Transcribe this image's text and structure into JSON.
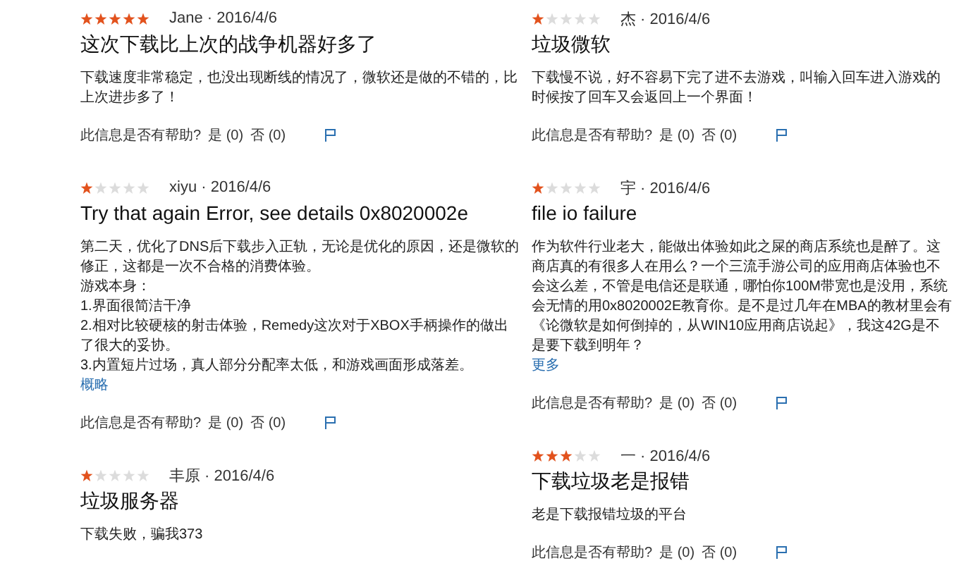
{
  "columns": [
    {
      "reviews": [
        {
          "stars": 5,
          "author": "Jane · 2016/4/6",
          "title": "这次下载比上次的战争机器好多了",
          "body": [
            "下载速度非常稳定，也没出现断线的情况了，微软还是做的不错的，比上次进步多了！"
          ],
          "helpful": {
            "prompt": "此信息是否有帮助?",
            "yes": "是 (0)",
            "no": "否 (0)"
          }
        },
        {
          "stars": 1,
          "author": "xiyu · 2016/4/6",
          "title": "Try that again Error, see details 0x8020002e",
          "body": [
            "第二天，优化了DNS后下载步入正轨，无论是优化的原因，还是微软的修正，这都是一次不合格的消费体验。",
            "游戏本身：",
            "1.界面很简洁干净",
            "2.相对比较硬核的射击体验，Remedy这次对于XBOX手柄操作的做出了很大的妥协。",
            "3.内置短片过场，真人部分分配率太低，和游戏画面形成落差。"
          ],
          "more": "概略",
          "helpful": {
            "prompt": "此信息是否有帮助?",
            "yes": "是 (0)",
            "no": "否 (0)"
          }
        },
        {
          "stars": 1,
          "author": "丰原 · 2016/4/6",
          "title": "垃圾服务器",
          "body": [
            "下载失败，骗我373"
          ]
        }
      ]
    },
    {
      "reviews": [
        {
          "stars": 1,
          "author": "杰 · 2016/4/6",
          "title": "垃圾微软",
          "body": [
            "下载慢不说，好不容易下完了进不去游戏，叫输入回车进入游戏的时候按了回车又会返回上一个界面！"
          ],
          "helpful": {
            "prompt": "此信息是否有帮助?",
            "yes": "是 (0)",
            "no": "否 (0)"
          }
        },
        {
          "stars": 1,
          "author": "宇 · 2016/4/6",
          "title": "file io failure",
          "body": [
            "作为软件行业老大，能做出体验如此之屎的商店系统也是醉了。这商店真的有很多人在用么？一个三流手游公司的应用商店体验也不会这么差，不管是电信还是联通，哪怕你100M带宽也是没用，系统会无情的用0x8020002E教育你。是不是过几年在MBA的教材里会有《论微软是如何倒掉的，从WIN10应用商店说起》，我这42G是不是要下载到明年？"
          ],
          "more": "更多",
          "helpful": {
            "prompt": "此信息是否有帮助?",
            "yes": "是 (0)",
            "no": "否 (0)"
          }
        },
        {
          "stars": 3,
          "author": "一 · 2016/4/6",
          "title": "下载垃圾老是报错",
          "body": [
            "老是下载报错垃圾的平台"
          ],
          "helpful": {
            "prompt": "此信息是否有帮助?",
            "yes": "是 (0)",
            "no": "否 (0)"
          }
        }
      ]
    }
  ]
}
